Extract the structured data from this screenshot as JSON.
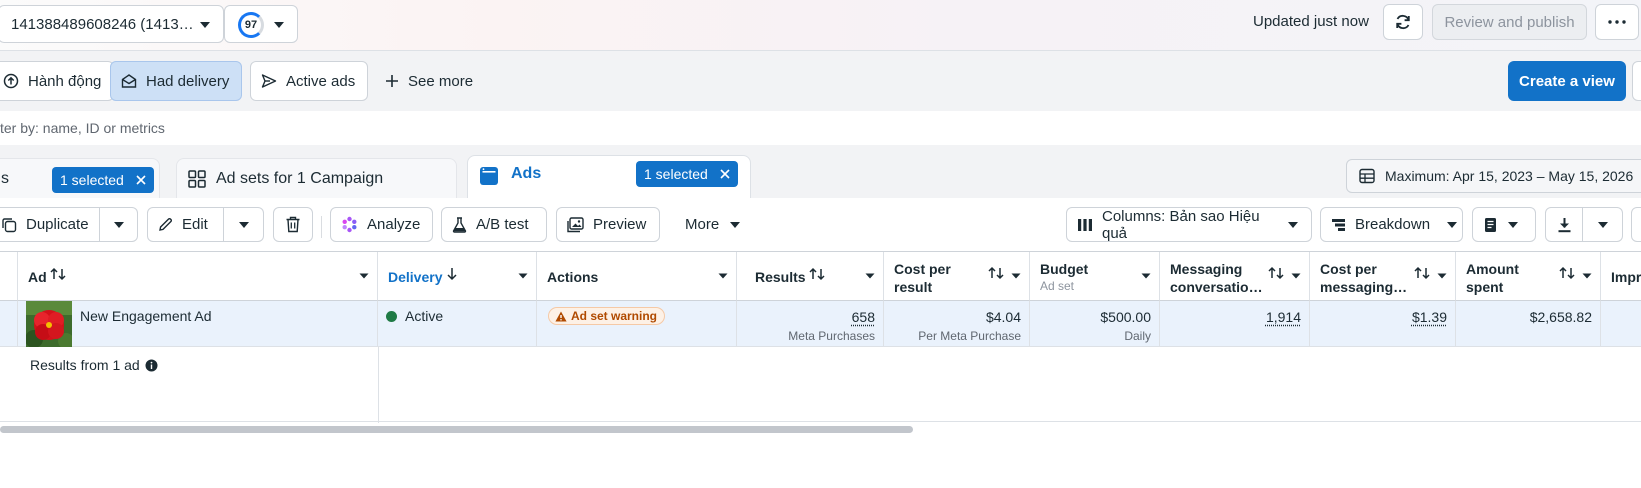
{
  "topbar": {
    "account": "141388489608246 (1413…",
    "score": "97",
    "updated": "Updated just now",
    "review_label": "Review and publish"
  },
  "filters": {
    "chips": [
      "Hành động",
      "Had delivery",
      "Active ads"
    ],
    "see_more": "See more",
    "create_view": "Create a view"
  },
  "search": {
    "placeholder": "ter by: name, ID or metrics"
  },
  "tabs": {
    "campaigns_partial": "s",
    "campaigns_selected": "1 selected",
    "adsets": "Ad sets for 1 Campaign",
    "ads": "Ads",
    "ads_selected": "1 selected"
  },
  "date_range": "Maximum: Apr 15, 2023 – May 15, 2026",
  "toolbar": {
    "duplicate": "Duplicate",
    "edit": "Edit",
    "analyze": "Analyze",
    "ab_test": "A/B test",
    "preview": "Preview",
    "more": "More",
    "columns": "Columns: Bản sao Hiệu quả",
    "breakdown": "Breakdown"
  },
  "table": {
    "headers": {
      "ad": "Ad",
      "delivery": "Delivery",
      "actions": "Actions",
      "results": "Results",
      "cost_per_result_1": "Cost per",
      "cost_per_result_2": "result",
      "budget": "Budget",
      "budget_sub": "Ad set",
      "messaging_1": "Messaging",
      "messaging_2": "conversatio…",
      "cost_msg_1": "Cost per",
      "cost_msg_2": "messaging…",
      "amount_1": "Amount",
      "amount_2": "spent",
      "impressions_partial": "Impr"
    },
    "row": {
      "ad_name": "New Engagement Ad",
      "delivery": "Active",
      "action_badge": "Ad set warning",
      "results": "658",
      "results_sub": "Meta Purchases",
      "cost_per_result": "$4.04",
      "cost_per_result_sub": "Per Meta Purchase",
      "budget": "$500.00",
      "budget_sub": "Daily",
      "messaging": "1,914",
      "cost_messaging": "$1.39",
      "amount_spent": "$2,658.82"
    },
    "footer": "Results from 1 ad"
  },
  "colors": {
    "accent": "#1272c8",
    "active_dot": "#1f7a45",
    "warning": "#b04a00"
  }
}
